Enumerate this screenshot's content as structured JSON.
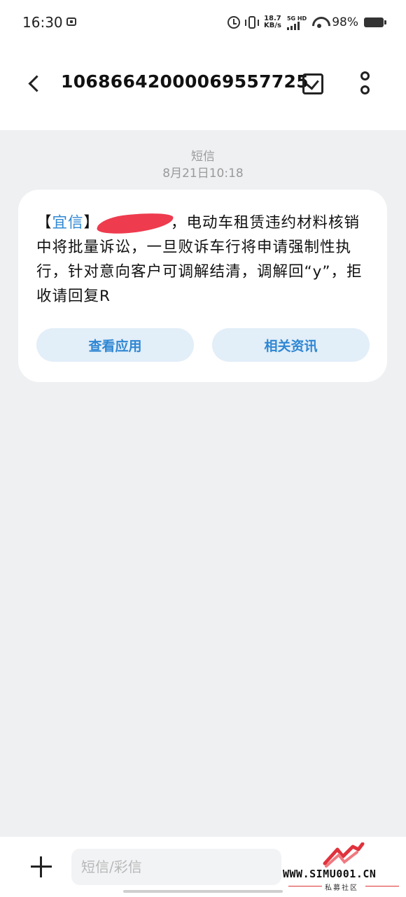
{
  "status_bar": {
    "time": "16:30",
    "speed_value": "18.7",
    "speed_unit": "KB/s",
    "network": "5G HD",
    "battery": "98%",
    "icons": [
      "app-icon",
      "alarm-icon",
      "vibrate-icon",
      "signal-icon",
      "wifi-icon",
      "battery-icon"
    ]
  },
  "header": {
    "title": "10686642000069557725",
    "back_icon": "chevron-left-icon",
    "select_icon": "checkbox-icon",
    "more_icon": "more-vertical-icon"
  },
  "conversation": {
    "message_type": "短信",
    "timestamp": "8月21日10:18",
    "message": {
      "bracket_open": "【",
      "sender_tag": "宜信",
      "bracket_close": "】",
      "redacted_text": "[redacted]",
      "text": "，电动车租赁违约材料核销中将批量诉讼，一旦败诉车行将申请强制性执行，针对意向客户可调解结清，调解回“y”，拒收请回复R"
    },
    "actions": [
      {
        "label": "查看应用"
      },
      {
        "label": "相关资讯"
      }
    ]
  },
  "composer": {
    "add_icon": "plus-icon",
    "placeholder": "短信/彩信"
  },
  "watermark": {
    "text": "WWW.SIMU001.CN",
    "subtext": "私募社区"
  },
  "colors": {
    "accent": "#2f87d3",
    "action_bg": "#e2eef8",
    "page_bg": "#eef0f2",
    "redaction": "#ee3b4e"
  }
}
